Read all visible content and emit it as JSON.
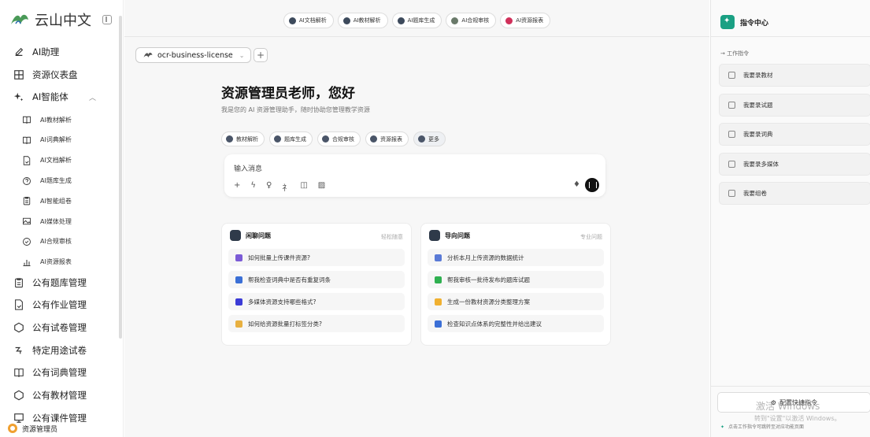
{
  "brand": {
    "name": "云山中文"
  },
  "sidebar": {
    "items": [
      {
        "label": "AI助理",
        "icon": "edit-icon",
        "level": 1
      },
      {
        "label": "资源仪表盘",
        "icon": "grid-icon",
        "level": 1
      },
      {
        "label": "AI智能体",
        "icon": "sparkle-icon",
        "level": 1,
        "expanded": true
      },
      {
        "label": "AI教材解析",
        "icon": "book-icon",
        "level": 2
      },
      {
        "label": "AI词典解析",
        "icon": "book-icon",
        "level": 2
      },
      {
        "label": "AI文档解析",
        "icon": "file-icon",
        "level": 2
      },
      {
        "label": "AI题库生成",
        "icon": "question-icon",
        "level": 2
      },
      {
        "label": "AI智能组卷",
        "icon": "clipboard-icon",
        "level": 2
      },
      {
        "label": "AI媒体处理",
        "icon": "image-icon",
        "level": 2
      },
      {
        "label": "AI合规审核",
        "icon": "shield-check-icon",
        "level": 2
      },
      {
        "label": "AI资源报表",
        "icon": "bar-chart-icon",
        "level": 2
      },
      {
        "label": "公有题库管理",
        "icon": "clipboard-icon",
        "level": 1
      },
      {
        "label": "公有作业管理",
        "icon": "file-icon",
        "level": 1
      },
      {
        "label": "公有试卷管理",
        "icon": "hexagon-icon",
        "level": 1
      },
      {
        "label": "特定用途试卷",
        "icon": "hook-icon",
        "level": 1
      },
      {
        "label": "公有词典管理",
        "icon": "book-icon",
        "level": 1
      },
      {
        "label": "公有教材管理",
        "icon": "hexagon-icon",
        "level": 1
      },
      {
        "label": "公有课件管理",
        "icon": "presentation-icon",
        "level": 1
      }
    ],
    "user": "资源管理员"
  },
  "quickbar": [
    {
      "label": "AI文档解析",
      "color": "#3d4a5c"
    },
    {
      "label": "AI教材解析",
      "color": "#3d4a5c"
    },
    {
      "label": "AI题库生成",
      "color": "#3d4a5c"
    },
    {
      "label": "AI合规审核",
      "color": "#6a7a6a"
    },
    {
      "label": "AI资源报表",
      "color": "#d0305a"
    }
  ],
  "session": {
    "tab_label": "ocr-business-license",
    "add_label": "+"
  },
  "greeting": {
    "title": "资源管理员老师，您好",
    "subtitle": "我是您的 AI 资源管理助手，随时协助您管理教学资源"
  },
  "chips": [
    "教材解析",
    "题库生成",
    "合规审核",
    "资源报表",
    "更多"
  ],
  "composer": {
    "placeholder": "输入消息"
  },
  "cards": [
    {
      "title": "闲聊问题",
      "tag": "轻松随意",
      "items": [
        {
          "text": "如何批量上传课件资源?",
          "color": "#7b5bd6"
        },
        {
          "text": "帮我检查词典中是否有重复词条",
          "color": "#3b6fd6"
        },
        {
          "text": "多媒体资源支持哪些格式?",
          "color": "#3b3bd6"
        },
        {
          "text": "如何给资源批量打标签分类?",
          "color": "#e8b040"
        }
      ]
    },
    {
      "title": "导向问题",
      "tag": "专业问题",
      "items": [
        {
          "text": "分析本月上传资源的数据统计",
          "color": "#5a7ad6"
        },
        {
          "text": "帮我审核一批待发布的题库试题",
          "color": "#2fb050"
        },
        {
          "text": "生成一份教材资源分类整理方案",
          "color": "#f0b030"
        },
        {
          "text": "检查知识点体系的完整性并给出建议",
          "color": "#3b6fd6"
        }
      ]
    }
  ],
  "right_panel": {
    "title": "指令中心",
    "section": "→ 工作指令",
    "items": [
      "我要录教材",
      "我要录试题",
      "我要录词典",
      "我要录多媒体",
      "我要组卷"
    ],
    "config_button": "配置快捷指令",
    "tip": "点击工作指令可跳转至对应功能页面",
    "watermark_1": "激活 Windows",
    "watermark_2": "转到\"设置\"以激活 Windows。"
  }
}
